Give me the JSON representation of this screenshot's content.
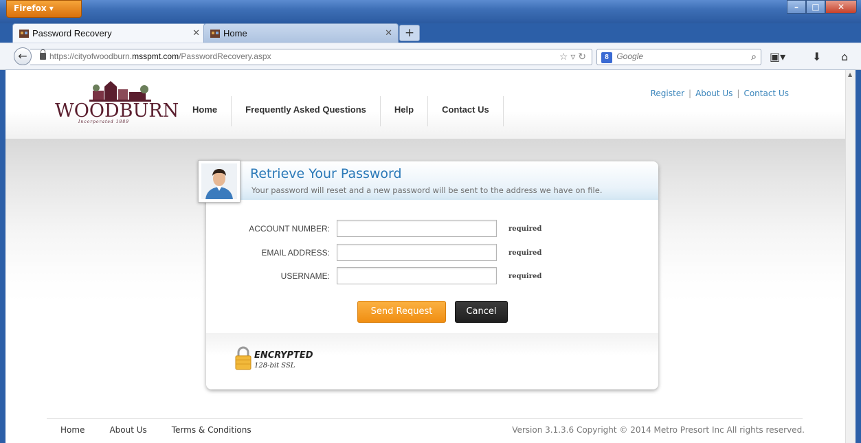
{
  "browser": {
    "menu_label": "Firefox",
    "tabs": [
      {
        "label": "Password Recovery",
        "active": true
      },
      {
        "label": "Home",
        "active": false
      }
    ],
    "new_tab": "+",
    "url_prefix": "https://cityofwoodburn.",
    "url_domain": "msspmt.com",
    "url_path": "/PasswordRecovery.aspx",
    "search_placeholder": "Google",
    "search_engine": "8"
  },
  "site": {
    "logo_text": "WOODBURN",
    "logo_sub": "Incorporated 1889",
    "nav": [
      "Home",
      "Frequently Asked Questions",
      "Help",
      "Contact Us"
    ],
    "top_links": [
      "Register",
      "About Us",
      "Contact Us"
    ]
  },
  "form": {
    "title": "Retrieve Your Password",
    "description": "Your password will reset and a new password will be sent to the address we have on file.",
    "fields": [
      {
        "label": "ACCOUNT NUMBER:",
        "value": "",
        "hint": "required"
      },
      {
        "label": "EMAIL ADDRESS:",
        "value": "",
        "hint": "required"
      },
      {
        "label": "USERNAME:",
        "value": "",
        "hint": "required"
      }
    ],
    "send_label": "Send Request",
    "cancel_label": "Cancel",
    "encrypted_title": "ENCRYPTED",
    "encrypted_sub": "128-bit SSL"
  },
  "footer": {
    "links": [
      "Home",
      "About Us",
      "Terms & Conditions"
    ],
    "copyright": "Version 3.1.3.6 Copyright © 2014 Metro Presort Inc All rights reserved."
  },
  "colors": {
    "accent_blue": "#2b79b8",
    "link_blue": "#3a85bb",
    "button_orange": "#f08e12",
    "button_dark": "#1f1f1f",
    "brand_maroon": "#5a1e2e"
  }
}
